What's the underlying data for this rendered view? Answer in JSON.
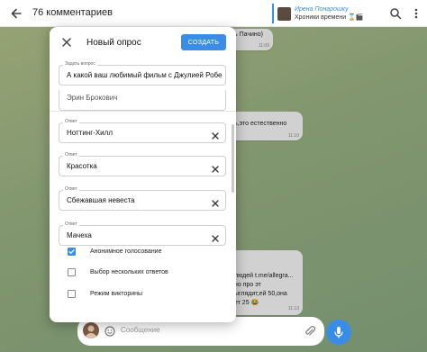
{
  "header": {
    "title": "76 комментариев",
    "pinned": {
      "name": "Ирена Понарошку",
      "subtitle": "Хроники времени ⌛🎬"
    }
  },
  "chat": {
    "bubbles": [
      {
        "text": "ь Пачино)",
        "time": "11:09"
      },
      {
        "text": "ь,это естественно",
        "time": "11:10"
      },
      {
        "text": "людей t.me/allegra...\nно про эт\nыглядит,ей 50,она\nет 25 😂",
        "time": "11:13"
      }
    ],
    "composer_placeholder": "Сообщение"
  },
  "dialog": {
    "title": "Новый опрос",
    "create_label": "СОЗДАТЬ",
    "question": {
      "label": "Задать вопрос",
      "value": "А какой ваш любимый фильм с Джулией Робе"
    },
    "partial_option": "Эрин Брокович",
    "options": [
      {
        "label": "Ответ",
        "value": "Ноттинг-Хилл"
      },
      {
        "label": "Ответ",
        "value": "Красотка"
      },
      {
        "label": "Ответ",
        "value": "Сбежавшая невеста"
      },
      {
        "label": "Ответ",
        "value": "Мачеха"
      }
    ],
    "settings": [
      {
        "label": "Анонимное голосование",
        "checked": true
      },
      {
        "label": "Выбор нескольких ответов",
        "checked": false
      },
      {
        "label": "Режим викторины",
        "checked": false
      }
    ]
  },
  "colors": {
    "accent": "#3a8de6",
    "background": "#9fb888"
  }
}
